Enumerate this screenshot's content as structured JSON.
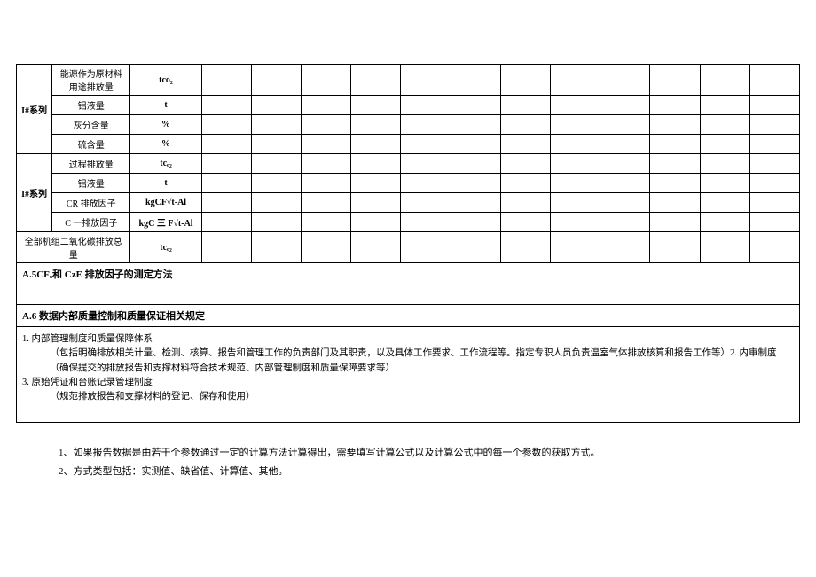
{
  "groupA": {
    "head": "I#系列",
    "rows": [
      {
        "label": "能源作为原材料用途排放量",
        "unit": "tco₂"
      },
      {
        "label": "铝液量",
        "unit": "t"
      },
      {
        "label": "灰分含量",
        "unit": "%"
      },
      {
        "label": "硫含量",
        "unit": "%"
      }
    ]
  },
  "groupB": {
    "head": "I#系列",
    "rows": [
      {
        "label": "过程排放量",
        "unit": "tcₒ₂"
      },
      {
        "label": "铝液量",
        "unit": "t"
      },
      {
        "label": "CR 排放因子",
        "unit": "kgCF√t-Al"
      },
      {
        "label": "C 一排放因子",
        "unit": "kgC 三 F√t-Al"
      }
    ]
  },
  "totalRow": {
    "label": "全部机组二氧化碳排放总量",
    "unit": "tcₒ₂"
  },
  "sectionA5": "A.5CFₓ和 CzE 排放因子的测定方法",
  "sectionA6": "A.6 数据内部质量控制和质量保证相关规定",
  "bodyA6": {
    "l1": "1. 内部管理制度和质量保障体系",
    "l1sub": "（包括明确排放相关计量、检测、核算、报告和管理工作的负责部门及其职责，以及具体工作要求、工作流程等。指定专职人员负责温室气体排放核算和报告工作等）2. 内审制度",
    "l2sub": "（确保提交的排放报告和支撑材料符合技术规范、内部管理制度和质量保障要求等）",
    "l3": "3. 原始凭证和台账记录管理制度",
    "l3sub": "（规范排放报告和支撑材料的登记、保存和使用）"
  },
  "notes": {
    "n1": "1、如果报告数据是由若干个参数通过一定的计算方法计算得出，需要填写计算公式以及计算公式中的每一个参数的获取方式。",
    "n2": "2、方式类型包括：实测值、缺省值、计算值、其他。"
  }
}
